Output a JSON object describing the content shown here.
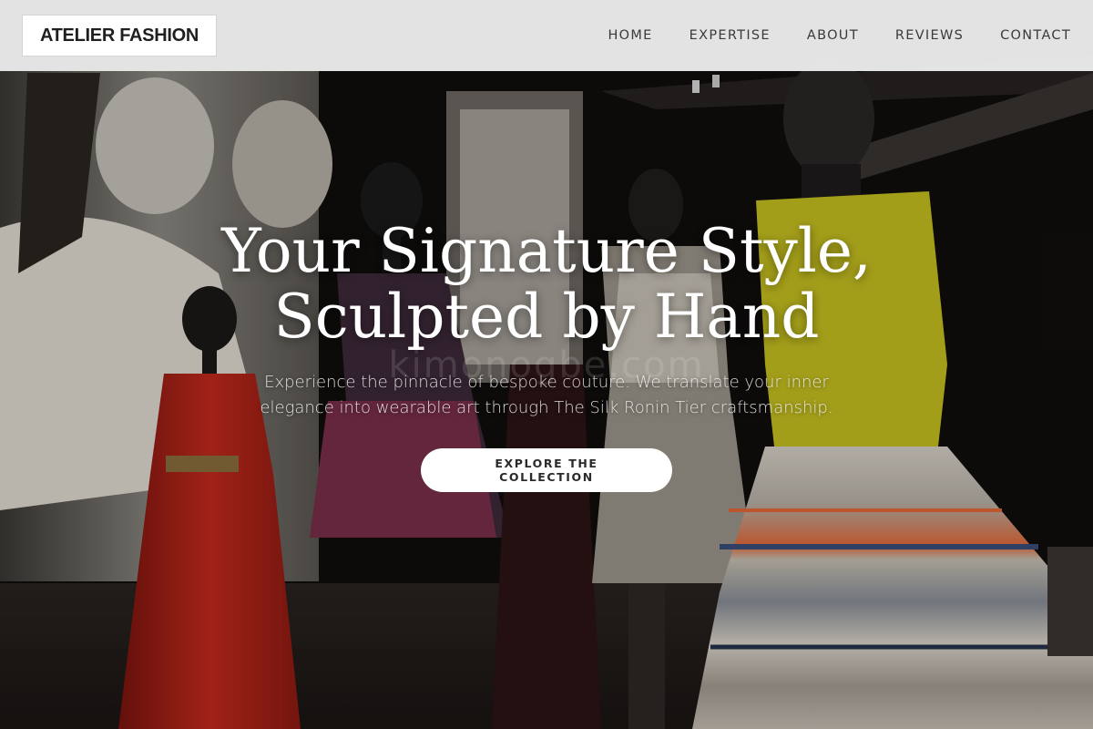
{
  "header": {
    "brand": "ATELIER FASHION",
    "nav": [
      {
        "label": "HOME"
      },
      {
        "label": "EXPERTISE"
      },
      {
        "label": "ABOUT"
      },
      {
        "label": "REVIEWS"
      },
      {
        "label": "CONTACT"
      }
    ]
  },
  "hero": {
    "headline": "Your Signature Style, Sculpted by Hand",
    "subtext": "Experience the pinnacle of bespoke couture. We translate your inner elegance into wearable art through The Silk Ronin Tier craftsmanship.",
    "cta_label": "EXPLORE THE COLLECTION",
    "watermark": "kimonogbe.com",
    "background_icon": "couture-exhibition-photo"
  },
  "colors": {
    "header_bg": "#ececec",
    "brand_box_bg": "#ffffff",
    "text_dark": "#1f1f1f",
    "hero_text": "#ffffff",
    "cta_bg": "#ffffff",
    "red_gown": "#b8231a",
    "yellow_top": "#c9c41e"
  }
}
